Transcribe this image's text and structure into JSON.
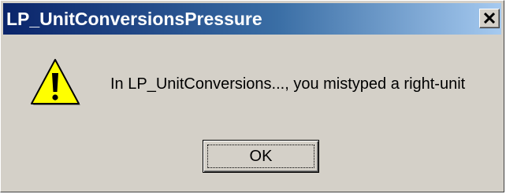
{
  "window": {
    "title": "LP_UnitConversionsPressure",
    "close_icon": "close-icon"
  },
  "dialog": {
    "icon": "warning-icon",
    "message": "In LP_UnitConversions..., you mistyped a right-unit",
    "ok_label": "OK"
  },
  "colors": {
    "titlebar_start": "#0a246a",
    "titlebar_end": "#a6caf0",
    "dialog_bg": "#d4d0c8",
    "warning_yellow": "#ffff00"
  }
}
